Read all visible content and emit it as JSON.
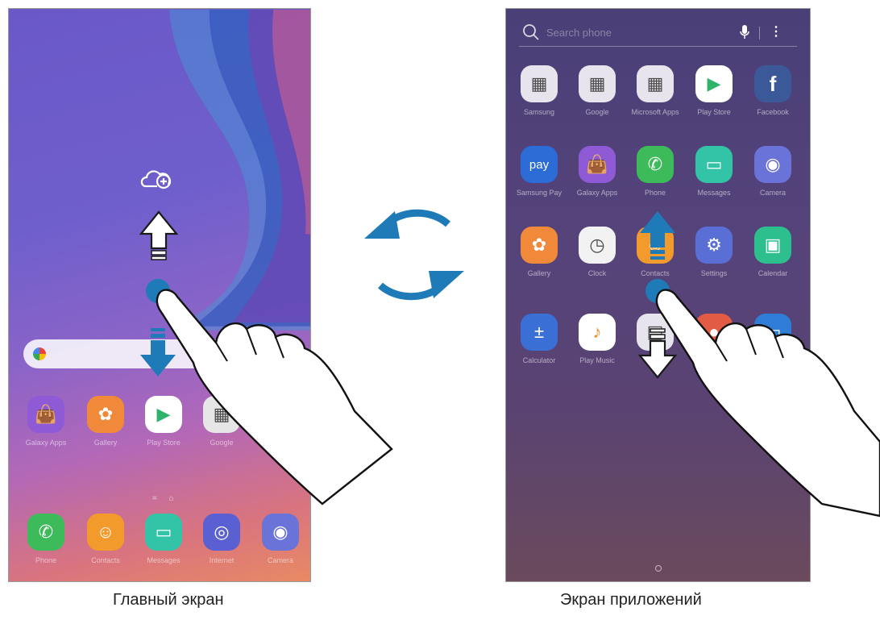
{
  "home": {
    "caption": "Главный экран",
    "dock_apps": [
      {
        "label": "Galaxy Apps",
        "icon": "galaxy-apps-icon",
        "color": "#8e5ad6"
      },
      {
        "label": "Gallery",
        "icon": "gallery-icon",
        "color": "#f08a3a"
      },
      {
        "label": "Play Store",
        "icon": "play-store-icon",
        "color": "#ffffff"
      },
      {
        "label": "Google",
        "icon": "google-folder-icon",
        "color": "#e6e6e6"
      }
    ],
    "bottom_apps": [
      {
        "label": "Phone",
        "icon": "phone-icon",
        "color": "#3dbb5a"
      },
      {
        "label": "Contacts",
        "icon": "contacts-icon",
        "color": "#f39a2c"
      },
      {
        "label": "Messages",
        "icon": "messages-icon",
        "color": "#33c4a8"
      },
      {
        "label": "Internet",
        "icon": "internet-icon",
        "color": "#5a5fd1"
      },
      {
        "label": "Camera",
        "icon": "camera-icon",
        "color": "#6a73d8"
      }
    ]
  },
  "apps": {
    "caption": "Экран приложений",
    "search_placeholder": "Search phone",
    "rows": [
      [
        {
          "label": "Samsung",
          "icon": "samsung-folder-icon",
          "color": "#e8e4ee"
        },
        {
          "label": "Google",
          "icon": "google-folder-icon",
          "color": "#e8e4ee"
        },
        {
          "label": "Microsoft Apps",
          "icon": "microsoft-folder-icon",
          "color": "#e8e4ee"
        },
        {
          "label": "Play Store",
          "icon": "play-store-icon",
          "color": "#ffffff"
        },
        {
          "label": "Facebook",
          "icon": "facebook-icon",
          "color": "#3b5998"
        }
      ],
      [
        {
          "label": "Samsung Pay",
          "icon": "samsung-pay-icon",
          "color": "#2b6cd6"
        },
        {
          "label": "Galaxy Apps",
          "icon": "galaxy-apps-icon",
          "color": "#8e5ad6"
        },
        {
          "label": "Phone",
          "icon": "phone-icon",
          "color": "#3dbb5a"
        },
        {
          "label": "Messages",
          "icon": "messages-icon",
          "color": "#33c4a8"
        },
        {
          "label": "Camera",
          "icon": "camera-icon",
          "color": "#6a73d8"
        }
      ],
      [
        {
          "label": "Gallery",
          "icon": "gallery-icon",
          "color": "#f08a3a"
        },
        {
          "label": "Clock",
          "icon": "clock-icon",
          "color": "#f2f2f2"
        },
        {
          "label": "Contacts",
          "icon": "contacts-icon",
          "color": "#f39a2c"
        },
        {
          "label": "Settings",
          "icon": "settings-icon",
          "color": "#5a6fd6"
        },
        {
          "label": "Calendar",
          "icon": "calendar-icon",
          "color": "#2ebf8f"
        }
      ],
      [
        {
          "label": "Calculator",
          "icon": "calculator-icon",
          "color": "#3a6fd6"
        },
        {
          "label": "Play Music",
          "icon": "play-music-icon",
          "color": "#ffffff"
        },
        {
          "label": "",
          "icon": "notes-icon",
          "color": "#e8e4ee"
        },
        {
          "label": "",
          "icon": "app-icon",
          "color": "#e25b45"
        },
        {
          "label": "",
          "icon": "my-files-icon",
          "color": "#2f7dd6"
        }
      ]
    ]
  }
}
